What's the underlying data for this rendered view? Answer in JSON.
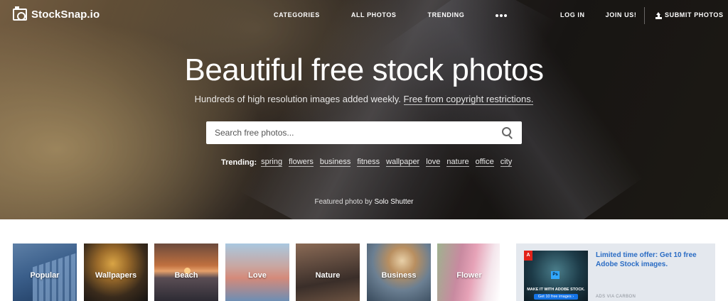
{
  "header": {
    "logo_text": "StockSnap.io",
    "nav": [
      {
        "label": "CATEGORIES"
      },
      {
        "label": "ALL PHOTOS"
      },
      {
        "label": "TRENDING"
      }
    ],
    "more_icon": "more-dots-icon",
    "login_label": "LOG IN",
    "join_label": "JOIN US!",
    "submit_label": "SUBMIT PHOTOS",
    "submit_icon": "upload-icon"
  },
  "hero": {
    "title": "Beautiful free stock photos",
    "subtitle_text": "Hundreds of high resolution images added weekly. ",
    "subtitle_link": "Free from copyright restrictions.",
    "search_placeholder": "Search free photos...",
    "search_icon": "search-icon",
    "trending_label": "Trending:",
    "trending_tags": [
      "spring",
      "flowers",
      "business",
      "fitness",
      "wallpaper",
      "love",
      "nature",
      "office",
      "city"
    ],
    "featured_prefix": "Featured photo by ",
    "featured_author": "Solo Shutter"
  },
  "categories": [
    {
      "label": "Popular"
    },
    {
      "label": "Wallpapers"
    },
    {
      "label": "Beach"
    },
    {
      "label": "Love"
    },
    {
      "label": "Nature"
    },
    {
      "label": "Business"
    },
    {
      "label": "Flower"
    }
  ],
  "ad": {
    "logo": "A",
    "ps_badge": "Ps",
    "image_caption": "MAKE IT WITH ADOBE STOCK.",
    "image_cta": "Get 10 free images ›",
    "text": "Limited time offer: Get 10 free Adobe Stock images.",
    "via": "ADS VIA CARBON"
  },
  "colors": {
    "ad_link": "#2a6cc4",
    "ad_background": "#e4e8ee",
    "adobe_red": "#e2231a"
  }
}
